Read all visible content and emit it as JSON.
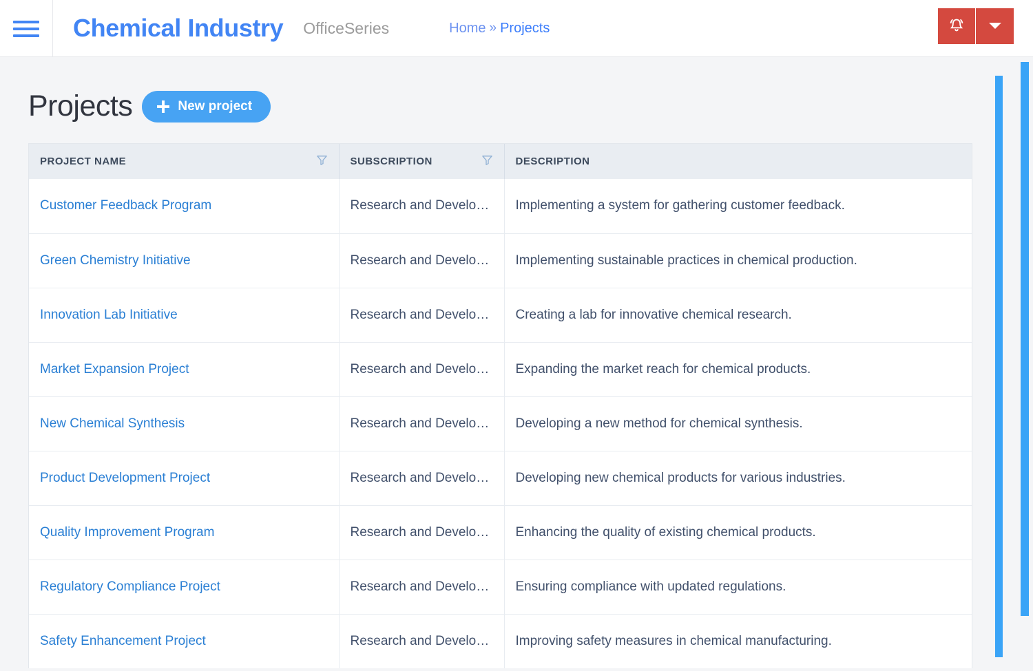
{
  "header": {
    "menu_icon": "hamburger-icon",
    "brand_title": "Chemical Industry",
    "brand_subtitle": "OfficeSeries",
    "breadcrumb": {
      "home": "Home",
      "separator": "»",
      "current": "Projects"
    },
    "actions": {
      "notifications_icon": "bell-icon",
      "dropdown_icon": "chevron-down-icon",
      "button_color": "#d4493f"
    }
  },
  "main": {
    "title": "Projects",
    "new_project_label": "New project",
    "new_project_icon": "plus-icon",
    "accent_color": "#47a3f3",
    "table": {
      "columns": [
        {
          "label": "PROJECT NAME",
          "filterable": true,
          "filter_icon": "filter-funnel-icon"
        },
        {
          "label": "SUBSCRIPTION",
          "filterable": true,
          "filter_icon": "filter-funnel-icon"
        },
        {
          "label": "DESCRIPTION",
          "filterable": false
        }
      ],
      "rows": [
        {
          "name": "Customer Feedback Program",
          "subscription": "Research and Develop…",
          "description": "Implementing a system for gathering customer feedback."
        },
        {
          "name": "Green Chemistry Initiative",
          "subscription": "Research and Develop…",
          "description": "Implementing sustainable practices in chemical production."
        },
        {
          "name": "Innovation Lab Initiative",
          "subscription": "Research and Develop…",
          "description": "Creating a lab for innovative chemical research."
        },
        {
          "name": "Market Expansion Project",
          "subscription": "Research and Develop…",
          "description": "Expanding the market reach for chemical products."
        },
        {
          "name": "New Chemical Synthesis",
          "subscription": "Research and Develop…",
          "description": "Developing a new method for chemical synthesis."
        },
        {
          "name": "Product Development Project",
          "subscription": "Research and Develop…",
          "description": "Developing new chemical products for various industries."
        },
        {
          "name": "Quality Improvement Program",
          "subscription": "Research and Develop…",
          "description": "Enhancing the quality of existing chemical products."
        },
        {
          "name": "Regulatory Compliance Project",
          "subscription": "Research and Develop…",
          "description": "Ensuring compliance with updated regulations."
        },
        {
          "name": "Safety Enhancement Project",
          "subscription": "Research and Develop…",
          "description": "Improving safety measures in chemical manufacturing."
        }
      ]
    }
  },
  "scrollbars": {
    "inner_thumb": "vertical-scrollbar-thumb",
    "outer_thumb": "page-scrollbar-thumb",
    "color": "#3aa4f7"
  }
}
